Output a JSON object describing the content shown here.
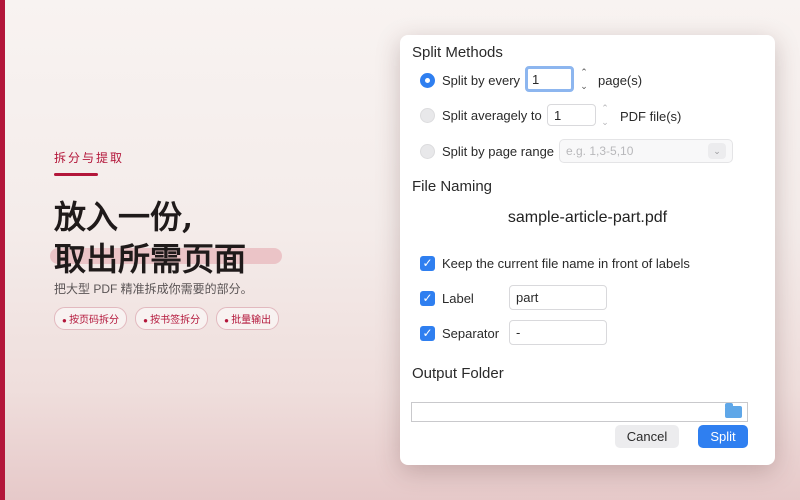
{
  "promo": {
    "kicker": "拆分与提取",
    "title_line1": "放入一份,",
    "title_line2": "取出所需页面",
    "description": "把大型 PDF 精准拆成你需要的部分。",
    "chips": [
      "按页码拆分",
      "按书签拆分",
      "批量输出"
    ],
    "accent_color": "#b3163a"
  },
  "dialog": {
    "split_methods_title": "Split Methods",
    "split_every": {
      "label": "Split by every",
      "value": "1",
      "unit": "page(s)",
      "selected": true
    },
    "split_average": {
      "label": "Split averagely to",
      "value": "1",
      "unit": "PDF file(s)",
      "selected": false
    },
    "split_range": {
      "label": "Split by page range",
      "placeholder": "e.g. 1,3-5,10",
      "selected": false
    },
    "file_naming_title": "File Naming",
    "filename_preview": "sample-article-part.pdf",
    "keep_name": {
      "label": "Keep the current file name in front of labels",
      "checked": true
    },
    "label_option": {
      "label": "Label",
      "value": "part",
      "checked": true
    },
    "separator_option": {
      "label": "Separator",
      "value": "-",
      "checked": true
    },
    "output_folder_title": "Output Folder",
    "output_folder_value": "",
    "cancel_label": "Cancel",
    "split_label": "Split",
    "primary_color": "#2f7ff0"
  }
}
